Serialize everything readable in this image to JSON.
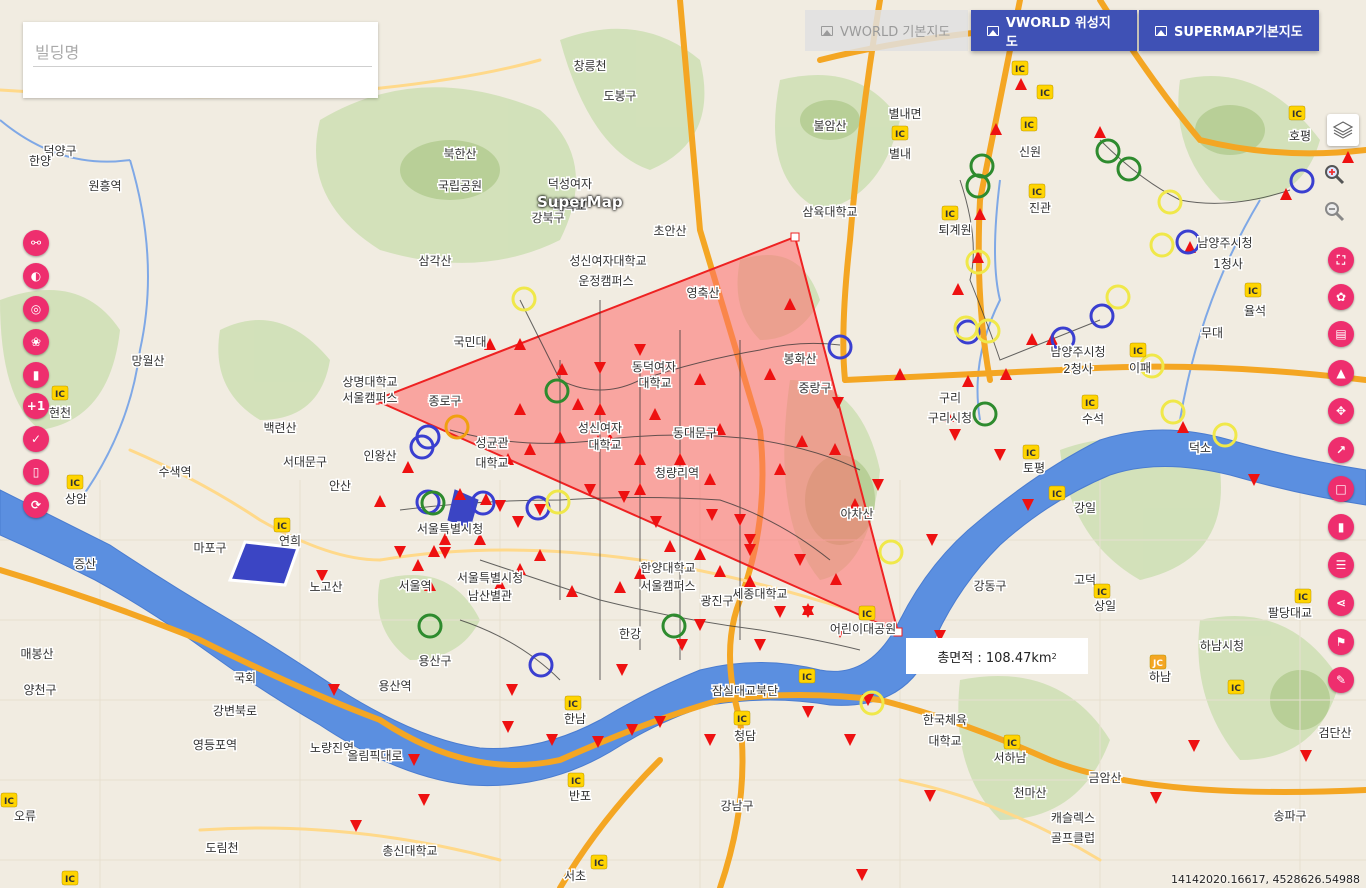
{
  "search": {
    "placeholder": "빌딩명"
  },
  "basemap_buttons": [
    {
      "label": "VWORLD 기본지도",
      "state": "disabled",
      "icon": "image-icon"
    },
    {
      "label": "VWORLD 위성지도",
      "state": "active",
      "icon": "image-icon"
    },
    {
      "label": "SUPERMAP기본지도",
      "state": "active",
      "icon": "image-icon"
    }
  ],
  "watermark": "SuperMap",
  "measure": {
    "label": "총면적 : 108.47km",
    "unit_sup": "2"
  },
  "coordinates": "14142020.16617, 4528626.54988",
  "colors": {
    "accent": "#3f51b5",
    "fab": "#ee2e6e",
    "polygon_fill": "#ff6b6b",
    "polygon_stroke": "#ee2222"
  },
  "left_toolbar_icons": [
    "key-icon",
    "contrast-icon",
    "target-icon",
    "color-palette-icon",
    "delete-icon",
    "plus-one-icon",
    "check-icon",
    "trash-icon",
    "refresh-icon"
  ],
  "right_toolbar_icons": [
    "fullscreen-icon",
    "pets-icon",
    "web-icon",
    "terrain-icon",
    "move-icon",
    "timeline-icon",
    "square-icon",
    "delete-icon",
    "assignment-icon",
    "share-icon",
    "run-icon",
    "brush-icon"
  ],
  "map_labels": [
    "도봉구",
    "불암산",
    "별내면",
    "별내",
    "창릉천",
    "북한산",
    "국립공원",
    "덕성여자",
    "대학교",
    "삼육대학교",
    "퇴계원",
    "신원",
    "진관",
    "호평",
    "덕양구",
    "원흥역",
    "한양",
    "삼각산",
    "성신여자대학교",
    "운정캠퍼스",
    "초안산",
    "영축산",
    "강북구",
    "국민대",
    "상명대학교",
    "서울캠퍼스",
    "종로구",
    "동덕여자",
    "대학교",
    "봉화산",
    "중랑구",
    "남양주시청",
    "2청사",
    "이패",
    "율석",
    "무대",
    "남양주시청",
    "1청사",
    "망월산",
    "백련산",
    "서대문구",
    "인왕산",
    "성균관",
    "대학교",
    "성신여자",
    "대학교",
    "동대문구",
    "청량리역",
    "구리",
    "구리시청",
    "수석",
    "토평",
    "강일",
    "덕소",
    "수색역",
    "안산",
    "아차산",
    "현천",
    "상암",
    "마포구",
    "연희",
    "서울특별시청",
    "서울역",
    "노고산",
    "서울특별시청",
    "남산별관",
    "한양대학교",
    "서울캠퍼스",
    "세종대학교",
    "광진구",
    "어린이대공원",
    "강동구",
    "고덕",
    "상일",
    "증산",
    "팔당대교",
    "하남",
    "하남시청",
    "용산구",
    "한강",
    "매봉산",
    "용산역",
    "국회",
    "잠실대교북단",
    "한남",
    "청담",
    "한국체육",
    "대학교",
    "서하남",
    "금암산",
    "검단산",
    "양천구",
    "영등포역",
    "노량진역",
    "강변북로",
    "올림픽대로",
    "서초",
    "반포",
    "강남구",
    "천마산",
    "캐슬렉스",
    "골프클럽",
    "총신대학교",
    "오류",
    "도림천",
    "송파구"
  ]
}
